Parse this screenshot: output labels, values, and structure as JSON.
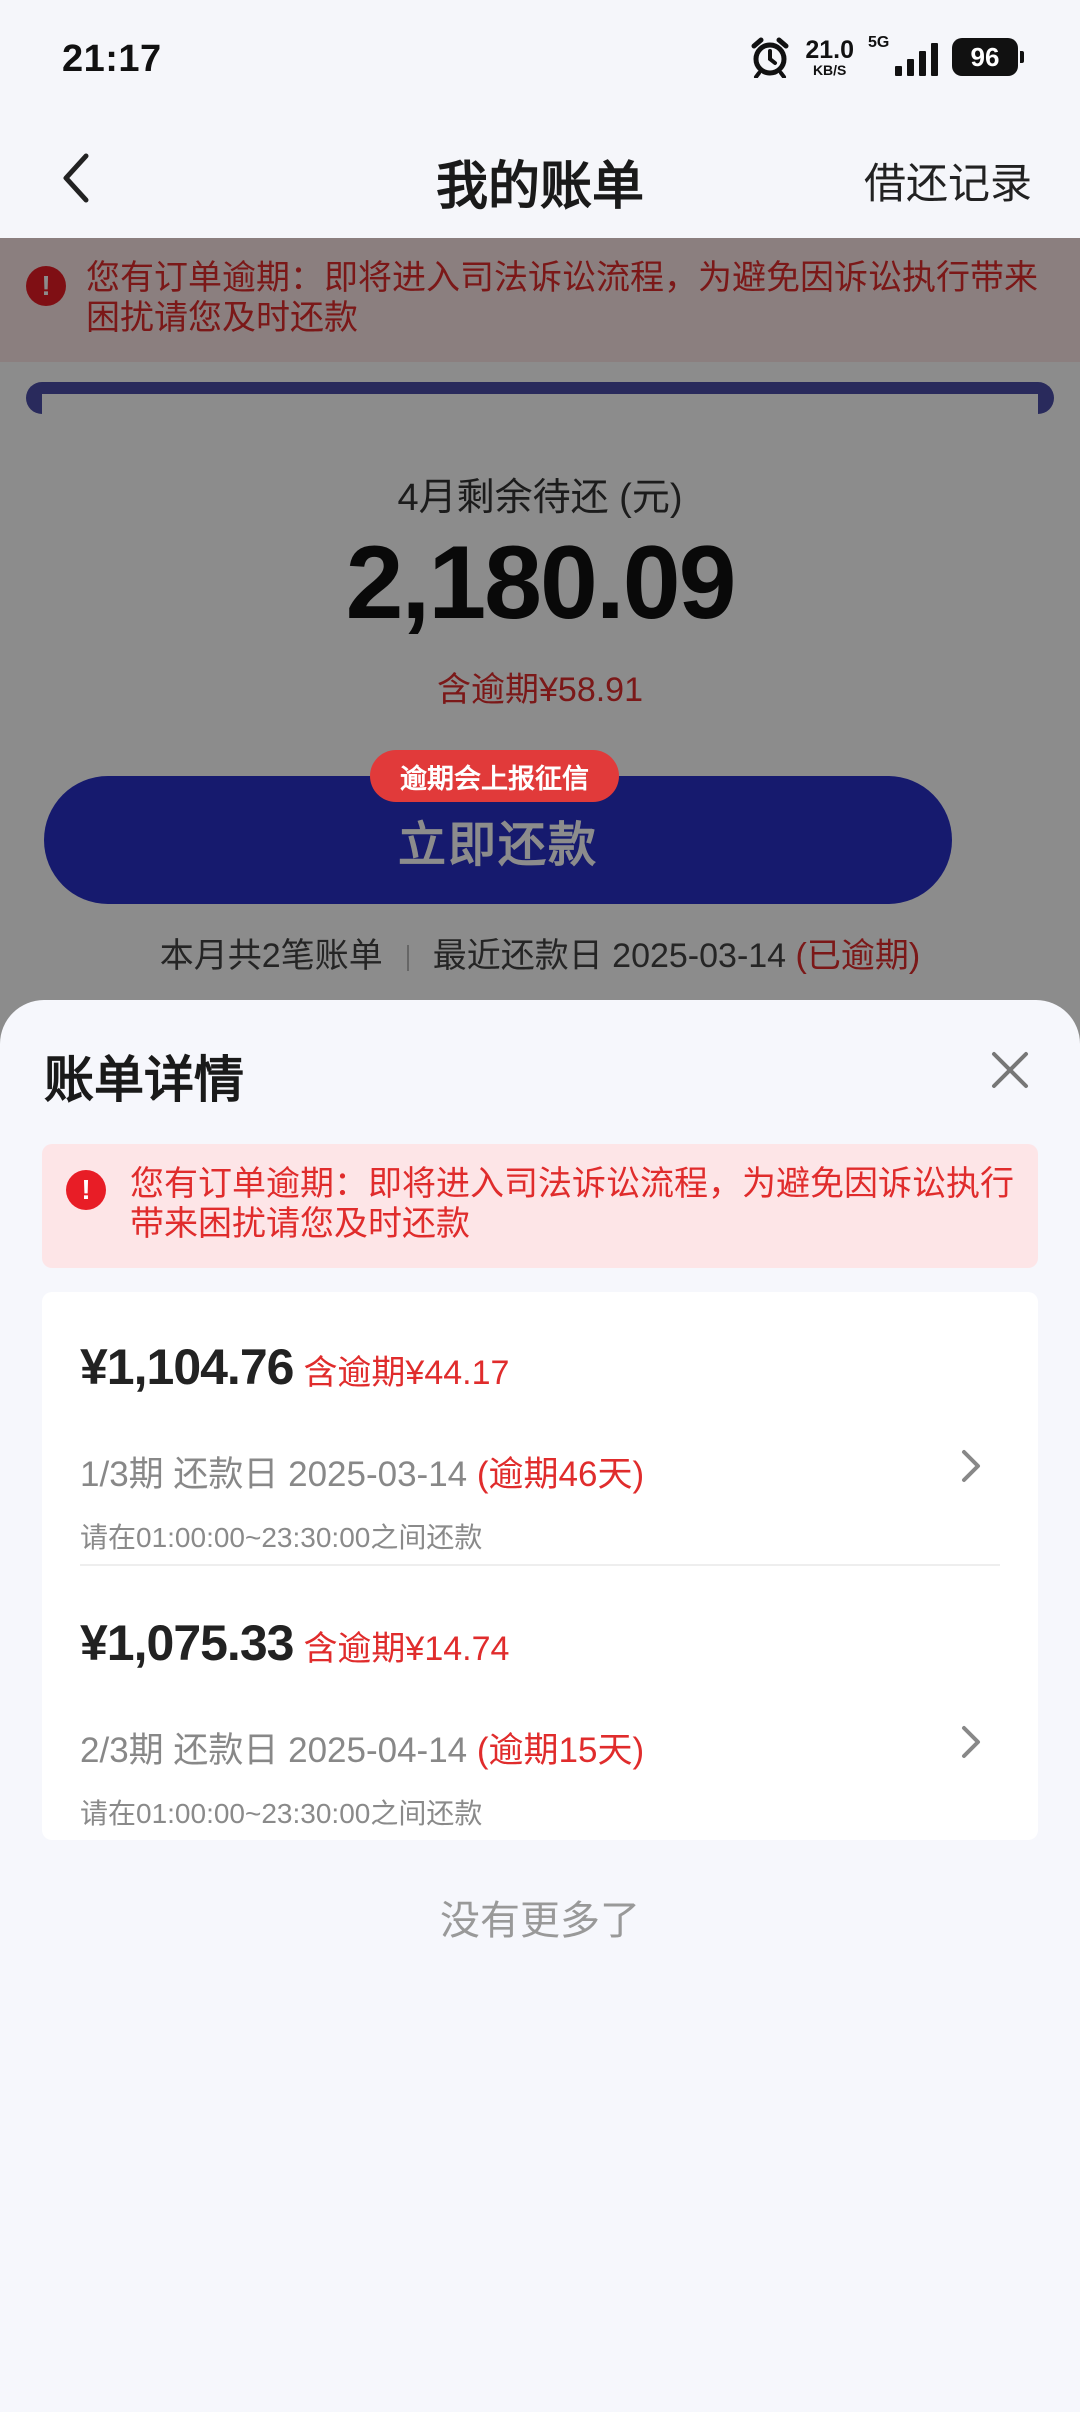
{
  "status_bar": {
    "time": "21:17",
    "net_speed": "21.0",
    "net_unit": "KB/S",
    "network": "5G",
    "battery": "96",
    "icons": [
      "alarm-icon",
      "signal-icon",
      "battery-icon"
    ]
  },
  "header": {
    "title": "我的账单",
    "right_link": "借还记录",
    "back_icon": "chevron-left-icon"
  },
  "background": {
    "warning": "您有订单逾期：即将进入司法诉讼流程，为避免因诉讼执行带来困扰请您及时还款",
    "month_label": "4月剩余待还 (元)",
    "remaining_amount": "2,180.09",
    "overdue_included": "含逾期¥58.91",
    "credit_tag": "逾期会上报征信",
    "pay_button": "立即还款",
    "bill_count": "本月共2笔账单",
    "recent_due": "最近还款日 2025-03-14",
    "recent_due_status": "(已逾期)"
  },
  "sheet": {
    "title": "账单详情",
    "close_icon": "close-icon",
    "warning": "您有订单逾期：即将进入司法诉讼流程，为避免因诉讼执行带来困扰请您及时还款",
    "items": [
      {
        "amount": "¥1,104.76",
        "overdue_amount": "含逾期¥44.17",
        "due_text": "1/3期 还款日 2025-03-14",
        "overdue_days": "(逾期46天)",
        "note": "请在01:00:00~23:30:00之间还款"
      },
      {
        "amount": "¥1,075.33",
        "overdue_amount": "含逾期¥14.74",
        "due_text": "2/3期 还款日 2025-04-14",
        "overdue_days": "(逾期15天)",
        "note": "请在01:00:00~23:30:00之间还款"
      }
    ],
    "footer": "没有更多了"
  },
  "colors": {
    "accent_blue": "#2830c8",
    "warning_red": "#e02c2c",
    "warning_bg": "#fde5e7"
  }
}
